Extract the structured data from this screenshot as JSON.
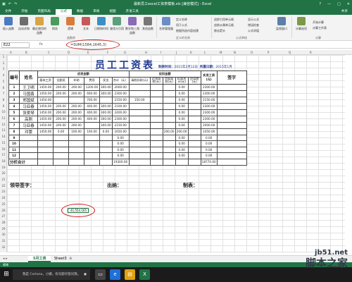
{
  "window": {
    "title": "最新员工excel工资表模板.xls [兼容模式] - Excel",
    "controls": [
      "?",
      "—",
      "□",
      "✕"
    ]
  },
  "ribbon": {
    "tabs": [
      "文件",
      "开始",
      "页面布局",
      "公式",
      "数据",
      "审阅",
      "视图",
      "开发工具"
    ],
    "active_tab": "公式",
    "share_label": "共享",
    "buttons": [
      "插入函数",
      "自动求和",
      "最近使用的函数",
      "财务",
      "逻辑",
      "文本",
      "日期和时间",
      "查找与引用",
      "数学和三角函数",
      "其他函数",
      "名称管理器",
      "计算选项"
    ],
    "small_buttons": [
      "定义名称",
      "用于公式",
      "根据所选内容创建",
      "追踪引用单元格",
      "追踪从属单元格",
      "移去箭头",
      "显示公式",
      "错误检查",
      "公式求值",
      "监视窗口",
      "开始计算",
      "计算工作表"
    ],
    "group_labels": [
      "函数库",
      "定义的名称",
      "公式审核",
      "计算"
    ]
  },
  "formula_bar": {
    "name_box": "E22",
    "fx_label": "fx",
    "formula": "=SUM(1584,1645,3)"
  },
  "columns": [
    "A",
    "B",
    "C",
    "D",
    "E",
    "F",
    "G",
    "H",
    "I",
    "J",
    "K",
    "L",
    "M",
    "N",
    "O",
    "P",
    "Q",
    "R"
  ],
  "rows": [
    "1",
    "2",
    "3",
    "4",
    "5",
    "6",
    "7",
    "8",
    "9",
    "10",
    "11",
    "12",
    "13",
    "14",
    "15",
    "16",
    "17",
    "18",
    "19",
    "20",
    "21",
    "22",
    "23",
    "24",
    "25",
    "26",
    "27",
    "28",
    "29",
    "30",
    "31",
    "32"
  ],
  "sheet": {
    "title": "员工工资表",
    "date_label": "制表时间：",
    "date_value": "2015年2月12日",
    "period_label": "所属日期：",
    "period_value": "2015年1月",
    "header": {
      "index": "编号",
      "name": "姓名",
      "payable": "应发金额",
      "deduct": "应扣金额",
      "net": "实发工资(元)",
      "sign": "签字",
      "sub": [
        "基本工资",
        "全勤奖",
        "补助",
        "费用",
        "奖金",
        "合计（元）",
        "请假扣款(元)",
        "迟到扣款(元)",
        "罚款扣款(元)",
        "扣款合计(元)",
        "应扣税(元)"
      ]
    },
    "rows": [
      {
        "no": "1",
        "name": "王卫明",
        "vals": [
          "1450.00",
          "200.00",
          "200.00",
          "1200.00",
          "300.00",
          "2000.00",
          "",
          "",
          "",
          "0.00",
          "",
          "2300.00"
        ]
      },
      {
        "no": "2",
        "name": "马国鑫",
        "vals": [
          "1450.00",
          "200.00",
          "200.00",
          "600.00",
          "300.00",
          "2300.00",
          "",
          "",
          "",
          "0.00",
          "",
          "2300.00"
        ]
      },
      {
        "no": "3",
        "name": "郑国斌",
        "vals": [
          "1450.00",
          "",
          "",
          "700.00",
          "",
          "2150.00",
          "",
          "",
          "",
          "0.00",
          "",
          "2150.00"
        ]
      },
      {
        "no": "4",
        "name": "马亚春",
        "vals": [
          "1450.00",
          "200.00",
          "200.00",
          "400.00",
          "300.00",
          "2100.00",
          "",
          "",
          "",
          "0.00",
          "",
          "2300.00"
        ]
      },
      {
        "no": "5",
        "name": "张爱琴",
        "vals": [
          "1450.00",
          "200.00",
          "200.00",
          "400.00",
          "300.00",
          "2400.00",
          "",
          "",
          "",
          "0.00",
          "",
          "2300.00"
        ]
      },
      {
        "no": "6",
        "name": "高刚",
        "vals": [
          "1450.00",
          "200.00",
          "200.00",
          "400.00",
          "300.00",
          "2300.00",
          "",
          "",
          "",
          "0.00",
          "",
          "2300.00"
        ]
      },
      {
        "no": "7",
        "name": "马亚春",
        "vals": [
          "1450.00",
          "200.00",
          "200.00",
          "",
          "300.00",
          "2150.00",
          "",
          "",
          "",
          "0.00",
          "",
          "2000.00"
        ]
      },
      {
        "no": "8",
        "name": "邓蕾",
        "vals": [
          "1450.00",
          "0.00",
          "100.00",
          "100.00",
          "0.00",
          "1650.00",
          "",
          "",
          "200.00",
          "200.00",
          "",
          "1450.00"
        ]
      },
      {
        "no": "9",
        "name": "",
        "vals": [
          "",
          "",
          "",
          "",
          "",
          "0.00",
          "",
          "",
          "",
          "0.00",
          "",
          "0.00"
        ]
      },
      {
        "no": "10",
        "name": "",
        "vals": [
          "",
          "",
          "",
          "",
          "",
          "0.00",
          "",
          "",
          "",
          "0.00",
          "",
          "0.00"
        ]
      },
      {
        "no": "11",
        "name": "",
        "vals": [
          "",
          "",
          "",
          "",
          "",
          "0.00",
          "",
          "",
          "",
          "0.00",
          "",
          "0.00"
        ]
      },
      {
        "no": "12",
        "name": "",
        "vals": [
          "",
          "",
          "",
          "",
          "",
          "0.00",
          "",
          "",
          "",
          "0.00",
          "",
          "0.00"
        ]
      }
    ],
    "total_label": "分栏合计",
    "total_amount": "19300.00",
    "total_net": "18770.00",
    "deduct_row3": "150.00",
    "sign_leader": "领导签字：",
    "sign_cashier": "出纳：",
    "sign_maker": "制表：",
    "cell_result": "41,554.165"
  },
  "sheet_tabs": [
    "5月工资",
    "Sheet3"
  ],
  "active_sheet": "5月工资",
  "status": {
    "ready": "就绪"
  },
  "taskbar": {
    "search_placeholder": "我是 Cortana，小娜。有问题尽管问我。"
  },
  "watermark": {
    "site": "jb51.net",
    "cn": "脚本之家"
  },
  "colors": {
    "excel_green": "#217346",
    "title_blue": "#1f3a93",
    "annotation_red": "#d21a1a"
  }
}
